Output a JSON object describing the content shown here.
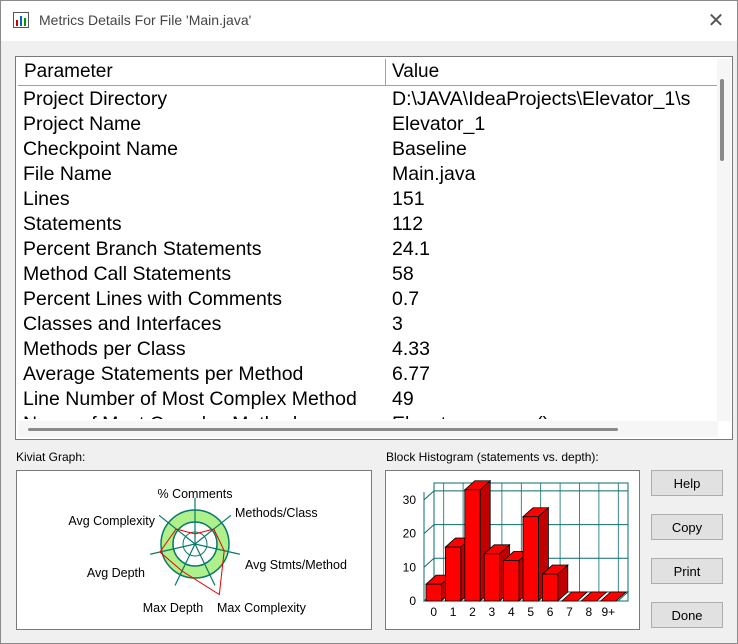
{
  "window": {
    "title": "Metrics Details For File 'Main.java'",
    "close_glyph": "✕"
  },
  "table": {
    "columns": [
      "Parameter",
      "Value"
    ],
    "rows": [
      {
        "param": "Project Directory",
        "value": "D:\\JAVA\\IdeaProjects\\Elevator_1\\s"
      },
      {
        "param": "Project Name",
        "value": "Elevator_1"
      },
      {
        "param": "Checkpoint Name",
        "value": "Baseline"
      },
      {
        "param": "File Name",
        "value": "Main.java"
      },
      {
        "param": "Lines",
        "value": "151"
      },
      {
        "param": "Statements",
        "value": "112"
      },
      {
        "param": "Percent Branch Statements",
        "value": "24.1"
      },
      {
        "param": "Method Call Statements",
        "value": "58"
      },
      {
        "param": "Percent Lines with Comments",
        "value": "0.7"
      },
      {
        "param": "Classes and Interfaces",
        "value": "3"
      },
      {
        "param": "Methods per Class",
        "value": "4.33"
      },
      {
        "param": "Average Statements per Method",
        "value": "6.77"
      },
      {
        "param": "Line Number of Most Complex Method",
        "value": "49"
      },
      {
        "param": "Name of Most Complex Method",
        "value": "Elevator.process()"
      }
    ]
  },
  "kiviat": {
    "label": "Kiviat Graph:",
    "axes": [
      "% Comments",
      "Methods/Class",
      "Avg Stmts/Method",
      "Max Complexity",
      "Max Depth",
      "Avg Depth",
      "Avg Complexity"
    ],
    "ring_color": "#aef08a",
    "line_color": "#0b7a6c"
  },
  "histogram": {
    "label": "Block Histogram (statements vs. depth):",
    "bar_color": "#ff0000"
  },
  "chart_data": {
    "type": "bar",
    "categories": [
      "0",
      "1",
      "2",
      "3",
      "4",
      "5",
      "6",
      "7",
      "8",
      "9+"
    ],
    "values": [
      5,
      16,
      33,
      14,
      12,
      25,
      8,
      0,
      0,
      0
    ],
    "ylim": [
      0,
      35
    ],
    "yticks": [
      0,
      10,
      20,
      30
    ],
    "grid": true
  },
  "buttons": {
    "help": "Help",
    "copy": "Copy",
    "print": "Print",
    "done": "Done"
  }
}
